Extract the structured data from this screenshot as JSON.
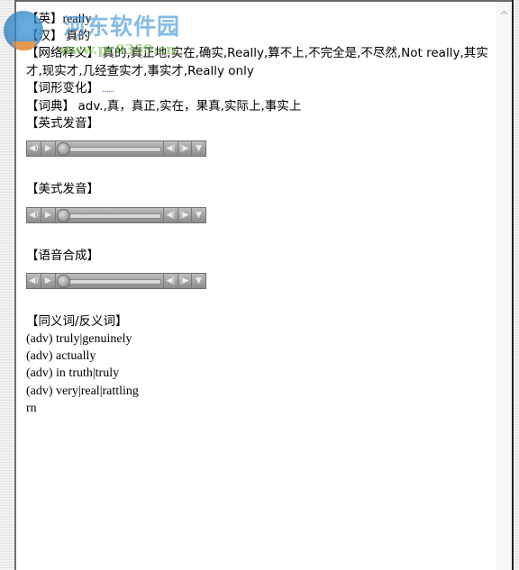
{
  "watermark": {
    "title": "河东软件园",
    "url": "www.pc0359.cn"
  },
  "entry": {
    "en_label": "【英】",
    "en_value": "really",
    "zh_label": "【汉】",
    "zh_value": "真的",
    "web_label": "【网络释义】",
    "web_value": "真的,真正地,实在,确实,Really,算不上,不完全是,不尽然,Not really,其实才,现实才,几经查实才,事实才,Really only",
    "forms_label": "【词形变化】",
    "forms_value": "......",
    "dict_label": "【词典】",
    "dict_value": "adv.,真，真正,实在，果真,实际上,事实上",
    "uk_pron_label": "【英式发音】",
    "us_pron_label": "【美式发音】",
    "tts_label": "【语音合成】",
    "syn_label": "【同义词/反义词】",
    "synonyms": [
      "(adv) truly|genuinely",
      "(adv) actually",
      "(adv) in truth|truly",
      "(adv) very|real|rattling",
      "rn"
    ]
  },
  "players": [
    {
      "name": "uk",
      "progress": 0
    },
    {
      "name": "us",
      "progress": 0
    },
    {
      "name": "tts",
      "progress": 0
    }
  ],
  "icons": {
    "volume": "◀)",
    "play": "▶",
    "prev": "◀|",
    "next": "|▶",
    "menu": "▼",
    "scroll_up": "^"
  }
}
